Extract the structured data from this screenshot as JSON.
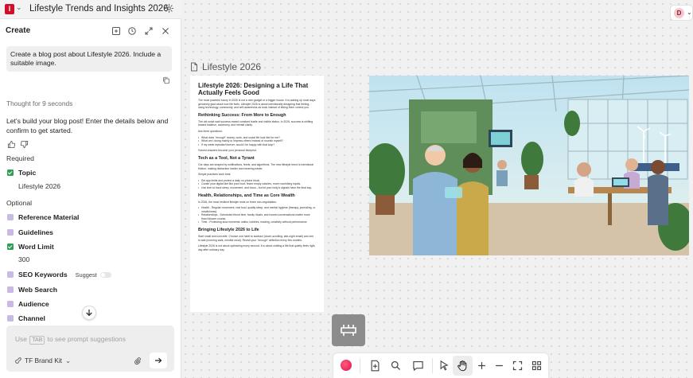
{
  "app": {
    "logo_text": "I",
    "document_title": "Lifestyle Trends and Insights 2026"
  },
  "panel": {
    "title": "Create",
    "user_prompt": "Create a blog post about Lifestyle 2026. Include a suitable image.",
    "thought_label": "Thought for 9 seconds",
    "assistant_message": "Let's build your blog post! Enter the details below and confirm to get started.",
    "required_label": "Required",
    "optional_label": "Optional",
    "required_fields": [
      {
        "label": "Topic",
        "value": "Lifestyle 2026",
        "checked": true
      }
    ],
    "optional_fields": [
      {
        "label": "Reference Material",
        "checked": false
      },
      {
        "label": "Guidelines",
        "checked": false
      },
      {
        "label": "Word Limit",
        "value": "300",
        "checked": true
      },
      {
        "label": "SEO Keywords",
        "suggest_label": "Suggest",
        "checked": false
      },
      {
        "label": "Web Search",
        "checked": false
      },
      {
        "label": "Audience",
        "checked": false
      },
      {
        "label": "Channel",
        "checked": false
      }
    ],
    "composer": {
      "hint_prefix": "Use",
      "hint_key": "TAB",
      "hint_suffix": "to see prompt suggestions",
      "brand_kit_label": "TF Brand Kit"
    }
  },
  "canvas": {
    "user_initial": "D",
    "page_title": "Lifestyle 2026",
    "article": {
      "title": "Lifestyle 2026: Designing a Life That Actually Feels Good",
      "intro": "The most powerful luxury in 2026 is not a new gadget or a bigger house. It is waking up most days genuinely glad about how life feels. Lifestyle 2026 is about intentionally designing that feeling, using technology, community, and self-awareness as tools instead of letting them control you.",
      "sections": [
        {
          "heading": "Rethinking Success: From More to Enough",
          "paragraphs": [
            "The old script said success meant constant hustle and visible status. In 2026, success is shifting toward balance, autonomy, and mental clarity.",
            "Ask three questions:"
          ],
          "bullets": [
            "What does \"enough\" money, work, and social life look like for me?",
            "What am I doing mainly to impress others instead of nourish myself?",
            "If my week repeated forever, would I be happy with that loop?"
          ],
          "closing": "Honest answers become your personal blueprint."
        },
        {
          "heading": "Tech as a Tool, Not a Tyrant",
          "paragraphs": [
            "Our days are shaped by notifications, feeds, and algorithms. The new lifestyle trend is intentional friction: making distraction harder and meaning easier.",
            "Simple practices work best:"
          ],
          "bullets": [
            "Set app limits and protect a daily no-phone block.",
            "Curate your digital diet like your food: fewer empty calories, more nourishing inputs.",
            "Use tech to track sleep, movement, and focus - but let your body's signals have the final say."
          ],
          "closing": ""
        },
        {
          "heading": "Health, Relationships, and Time as Core Wealth",
          "paragraphs": [
            "In 2026, the most resilient lifestyle rests on three non-negotiables:"
          ],
          "bullets": [
            "Health - Regular movement, real food, quality sleep, and mental hygiene (therapy, journaling, or mindfulness).",
            "Relationships - Scheduled friend time, family rituals, and honest conversations matter more than follower counts.",
            "Time - Protecting slow moments: walks, hobbies, reading, creativity without performance."
          ],
          "closing": ""
        },
        {
          "heading": "Bringing Lifestyle 2026 to Life",
          "paragraphs": [
            "Start small and concrete. Choose one habit to subtract (doom-scrolling, late-night email) and one to add (morning walk, mindful meal). Revisit your \"enough\" definition every few months.",
            "Lifestyle 2026 is not about optimizing every second. It is about crafting a life that quietly feels right, day after ordinary day."
          ],
          "bullets": [],
          "closing": ""
        }
      ]
    },
    "image_description": "Illustration of people collaborating in a bright plant-filled workspace",
    "toolbar_icons": [
      "record-icon",
      "add-page-icon",
      "search-icon",
      "comment-icon",
      "pointer-icon",
      "hand-icon",
      "zoom-in-icon",
      "zoom-out-icon",
      "fit-screen-icon",
      "grid-icon"
    ]
  },
  "colors": {
    "brand": "#d0102a",
    "check": "#2e9e55",
    "optional_box": "#c9b9e6",
    "frame_button": "#8c8c8c"
  }
}
